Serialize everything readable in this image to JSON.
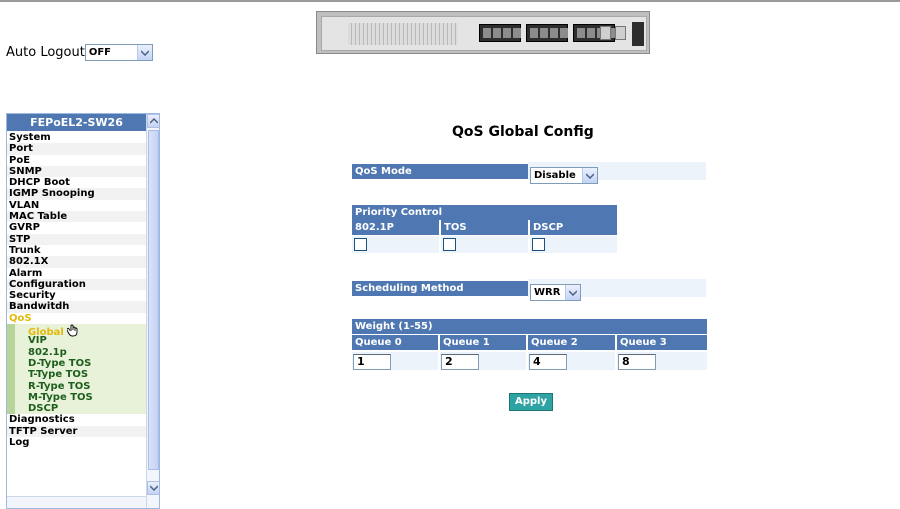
{
  "auto_logout": {
    "label": "Auto Logout",
    "value": "OFF"
  },
  "device": {
    "name": "FEPoEL2-SW26"
  },
  "sidebar": {
    "title": "FEPoEL2-SW26",
    "items": [
      {
        "label": "System"
      },
      {
        "label": "Port"
      },
      {
        "label": "PoE"
      },
      {
        "label": "SNMP"
      },
      {
        "label": "DHCP Boot"
      },
      {
        "label": "IGMP Snooping"
      },
      {
        "label": "VLAN"
      },
      {
        "label": "MAC Table"
      },
      {
        "label": "GVRP"
      },
      {
        "label": "STP"
      },
      {
        "label": "Trunk"
      },
      {
        "label": "802.1X"
      },
      {
        "label": "Alarm"
      },
      {
        "label": "Configuration"
      },
      {
        "label": "Security"
      },
      {
        "label": "Bandwitdh"
      },
      {
        "label": "QoS"
      }
    ],
    "qos_sub": [
      {
        "label": "Global"
      },
      {
        "label": "VIP"
      },
      {
        "label": "802.1p"
      },
      {
        "label": "D-Type TOS"
      },
      {
        "label": "T-Type TOS"
      },
      {
        "label": "R-Type TOS"
      },
      {
        "label": "M-Type TOS"
      },
      {
        "label": "DSCP"
      }
    ],
    "after": [
      {
        "label": "Diagnostics"
      },
      {
        "label": "TFTP Server"
      },
      {
        "label": "Log"
      }
    ]
  },
  "main": {
    "title": "QoS Global Config",
    "qos_mode": {
      "label": "QoS Mode",
      "value": "Disable"
    },
    "priority_control": {
      "header": "Priority Control",
      "columns": [
        "802.1P",
        "TOS",
        "DSCP"
      ],
      "checked": [
        false,
        false,
        false
      ]
    },
    "scheduling": {
      "label": "Scheduling Method",
      "value": "WRR"
    },
    "weight": {
      "header": "Weight (1-55)",
      "queues": [
        {
          "name": "Queue 0",
          "value": "1"
        },
        {
          "name": "Queue 1",
          "value": "2"
        },
        {
          "name": "Queue 2",
          "value": "4"
        },
        {
          "name": "Queue 3",
          "value": "8"
        }
      ]
    },
    "apply_label": "Apply"
  },
  "colors": {
    "header_blue": "#4f77b1",
    "row_light": "#edf3fb",
    "apply_teal": "#2ea3a3",
    "active_yellow": "#e3b90b",
    "sub_green_bg": "#e8f2d9"
  }
}
